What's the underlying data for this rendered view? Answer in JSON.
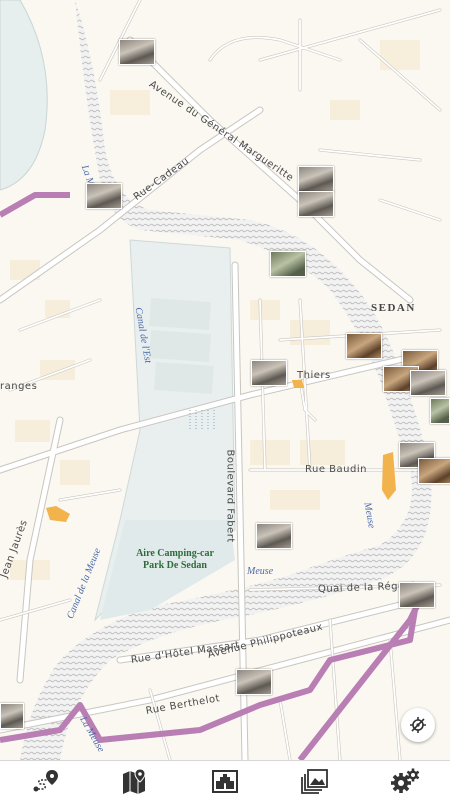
{
  "map": {
    "streets": {
      "gen_margueritte": "Avenue du Général Margueritte",
      "cadeau": "Rue-Cadeau",
      "thiers": "Thiers",
      "baudin": "Rue Baudin",
      "fabert": "Boulevard Fabert",
      "regente": "Quai de la Régente",
      "hotel_massart": "Rue d'Hôtel Massart",
      "philippoteaux": "Avenue Philippoteaux",
      "berthelot": "Rue Berthelot",
      "granges": "ranges",
      "jean_jaures": "Jean Jaurès"
    },
    "water": {
      "canal_est": "Canal de l'Est",
      "canal_meuse": "Canal de la Meuse",
      "meuse_center": "Meuse",
      "meuse_right": "Meuse",
      "meuse_top": "La Meuse",
      "meuse_bottom": "La Meuse"
    },
    "town_label": "SEDAN",
    "park_label_line1": "Aire Camping-car",
    "park_label_line2": "Park De Sedan",
    "colors": {
      "background": "#fbf8f1",
      "road": "#ffffff",
      "road_casing": "#c9c6c0",
      "water": "#e6eeee",
      "river_hatch": "#c8c8c8",
      "rail": "#b97fb4",
      "building": "#f6ecd8",
      "accent_orange": "#f2b24c"
    }
  },
  "controls": {
    "locate_icon": "crosshair-locate-icon"
  },
  "tabs": [
    {
      "name": "route",
      "icon": "route-icon"
    },
    {
      "name": "map",
      "icon": "map-pin-icon"
    },
    {
      "name": "monuments",
      "icon": "landmark-frame-icon"
    },
    {
      "name": "gallery",
      "icon": "photo-gallery-icon"
    },
    {
      "name": "settings",
      "icon": "gears-icon"
    }
  ]
}
